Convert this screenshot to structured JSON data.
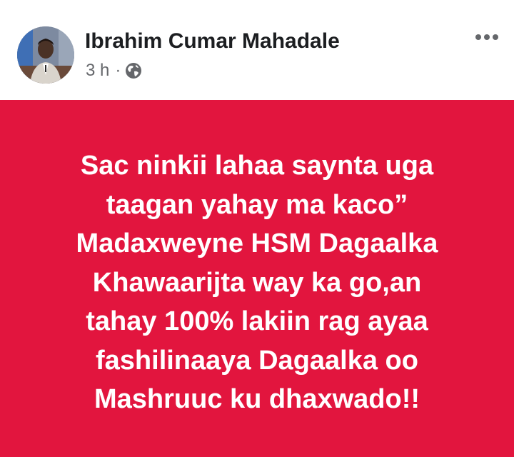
{
  "post": {
    "author": "Ibrahim Cumar Mahadale",
    "time": "3 h",
    "separator": "·",
    "audience_icon": "globe-icon",
    "menu_icon": "more-options-icon",
    "background_color": "#e2153e",
    "lines": [
      "Sac ninkii lahaa saynta uga",
      "taagan yahay ma kaco”",
      "Madaxweyne HSM Dagaalka",
      "Khawaarijta way ka go,an",
      "tahay 100% lakiin rag ayaa",
      "fashilinaaya Dagaalka oo",
      "Mashruuc ku dhaxwado!!"
    ]
  }
}
